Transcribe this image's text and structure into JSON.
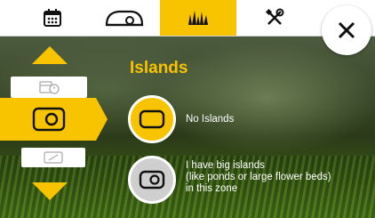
{
  "topbar": {
    "tabs": [
      {
        "icon": "calendar-icon"
      },
      {
        "icon": "mower-icon"
      },
      {
        "icon": "grass-icon",
        "active": true
      },
      {
        "icon": "tools-icon"
      }
    ],
    "close_icon": "close-icon"
  },
  "title": "Islands",
  "side_nav": {
    "items": [
      "calendar-schedule-icon",
      "island-icon",
      "slope-icon"
    ],
    "selected_index": 1
  },
  "options": [
    {
      "label_lines": [
        "No Islands"
      ],
      "icon": "no-island-icon",
      "selected": true
    },
    {
      "label_lines": [
        "I have big islands",
        "(like ponds or large flower beds)",
        "in this zone"
      ],
      "icon": "island-icon",
      "selected": false
    }
  ],
  "colors": {
    "accent": "#f8c400",
    "inactive": "#cfcfcf",
    "text": "#ffffff"
  }
}
